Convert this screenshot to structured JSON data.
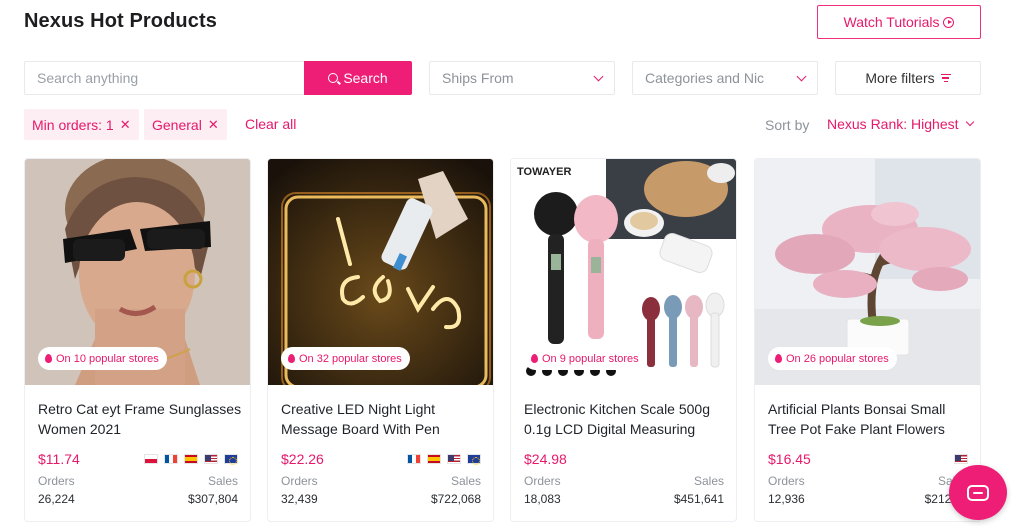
{
  "header": {
    "title": "Nexus Hot Products",
    "tutorial_label": "Watch Tutorials"
  },
  "filters": {
    "search_placeholder": "Search anything",
    "search_label": "Search",
    "ships_from": "Ships From",
    "categories": "Categories and Nic",
    "more_filters": "More filters"
  },
  "chips": [
    {
      "label": "Min orders: 1"
    },
    {
      "label": "General"
    }
  ],
  "clear_all": "Clear all",
  "sort": {
    "label": "Sort by",
    "value": "Nexus Rank: Highest"
  },
  "colors": {
    "accent": "#ee1d76",
    "accent_text": "#e6196b",
    "chip_bg": "#fdeef4"
  },
  "labels": {
    "orders": "Orders",
    "sales": "Sales"
  },
  "products": [
    {
      "title": "Retro Cat eyt Frame Sunglasses Women 2021",
      "stores": "On 10 popular stores",
      "price": "$11.74",
      "flags": [
        "pl",
        "fr",
        "es",
        "us",
        "eu"
      ],
      "orders": "26,224",
      "sales": "$307,804"
    },
    {
      "title": "Creative LED Night Light Message Board With Pen",
      "stores": "On 32 popular stores",
      "price": "$22.26",
      "flags": [
        "fr",
        "es",
        "us",
        "eu"
      ],
      "orders": "32,439",
      "sales": "$722,068"
    },
    {
      "title": "Electronic Kitchen Scale 500g 0.1g LCD Digital Measuring",
      "stores": "On 9 popular stores",
      "price": "$24.98",
      "flags": [],
      "orders": "18,083",
      "sales": "$451,641",
      "image_brand": "TOWAYER"
    },
    {
      "title": "Artificial Plants Bonsai Small Tree Pot Fake Plant Flowers",
      "stores": "On 26 popular stores",
      "price": "$16.45",
      "flags": [
        "us"
      ],
      "orders": "12,936",
      "sales": "$212,73"
    }
  ]
}
